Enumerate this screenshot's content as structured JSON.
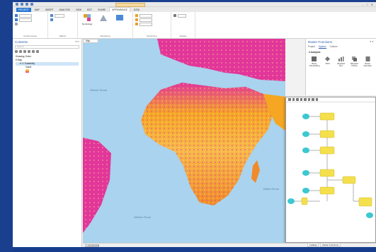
{
  "titlebar": {
    "context_tab": "",
    "app_title": "",
    "win_controls": [
      "–",
      "□",
      "✕"
    ]
  },
  "ribbon_tabs": [
    {
      "label": "PROJECT",
      "state": "project"
    },
    {
      "label": "MAP",
      "state": ""
    },
    {
      "label": "INSERT",
      "state": ""
    },
    {
      "label": "ANALYSIS",
      "state": ""
    },
    {
      "label": "VIEW",
      "state": ""
    },
    {
      "label": "EDIT",
      "state": ""
    },
    {
      "label": "SHARE",
      "state": ""
    },
    {
      "label": "APPEARANCE",
      "state": "active"
    },
    {
      "label": "DATA",
      "state": ""
    }
  ],
  "ribbon": {
    "control_group_label": "Control Group",
    "effects_label": "Effects",
    "rendering_label": "Rendering",
    "dimension_label": "Dimension",
    "display_label": "Display",
    "drawing_label": "",
    "symbology_label": "Symbology",
    "update_label": "Update"
  },
  "contents": {
    "title": "Contents",
    "search_placeholder": "Search",
    "drawing_order": "Drawing Order",
    "map_item": "Map",
    "layer_item": "Suitability",
    "legend_value": "Value"
  },
  "map": {
    "tab_label": "Map",
    "ocean_labels": [
      "Atlantic Ocean",
      "Atlantic Ocean",
      "Indian Ocean"
    ]
  },
  "status": {
    "scale": "1:28,000,000",
    "coords": "",
    "selected": ""
  },
  "geoprocessing": {
    "title": "Raster Functions",
    "tabs": [
      "Project",
      "System",
      "Custom"
    ],
    "section": "Analysis",
    "tools": [
      "Binary Thresholding",
      "NDVI",
      "Weighted Sum",
      "Weighted Overlay",
      "Raster Calculator"
    ]
  },
  "bottom_tabs": [
    "Catalog",
    "Raster Functions"
  ],
  "colors": {
    "accent": "#2b78d0",
    "ocean": "#a9d3ee",
    "land_high": "#e2369a",
    "land_mid": "#f5a623",
    "land_low": "#fde28a"
  }
}
